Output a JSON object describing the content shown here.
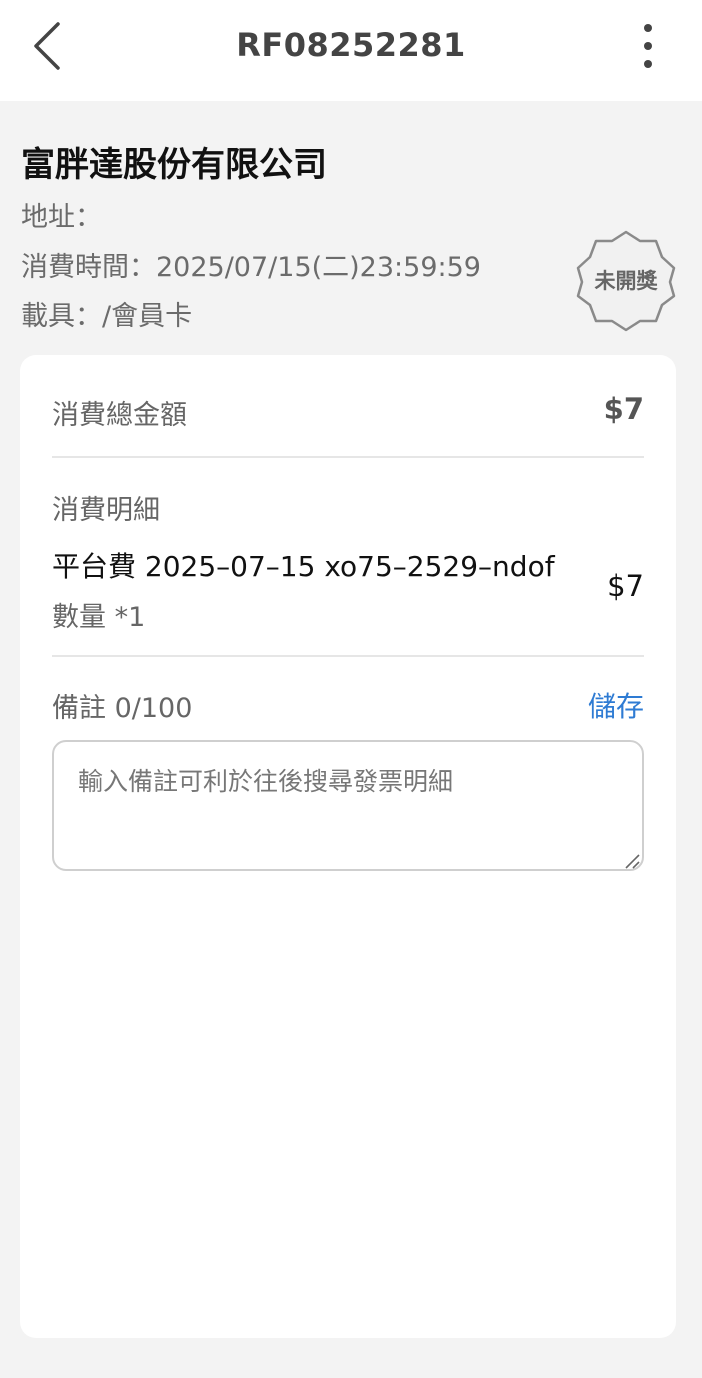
{
  "header": {
    "title": "RF08252281"
  },
  "invoice": {
    "company": "富胖達股份有限公司",
    "address": "地址：",
    "time": "消費時間：2025/07/15(二)23:59:59",
    "carrier": "載具：/會員卡",
    "badge": "未開獎"
  },
  "card": {
    "total_label": "消費總金額",
    "total_amount": "$7",
    "detail_label": "消費明細",
    "items": [
      {
        "name": "平台費 2025–07–15 xo75–2529–ndof",
        "quantity": "數量 *1",
        "price": "$7"
      }
    ],
    "note_label": "備註 0/100",
    "save_label": "儲存",
    "note_placeholder": "輸入備註可利於往後搜尋發票明細",
    "note_value": ""
  },
  "icons": {
    "back": "chevron-left-icon",
    "more": "more-vertical-icon",
    "badge": "seal-badge-icon",
    "grip": "resize-grip-icon"
  },
  "colors": {
    "accent": "#2e7bd3",
    "background": "#f3f3f3",
    "card": "#ffffff"
  }
}
